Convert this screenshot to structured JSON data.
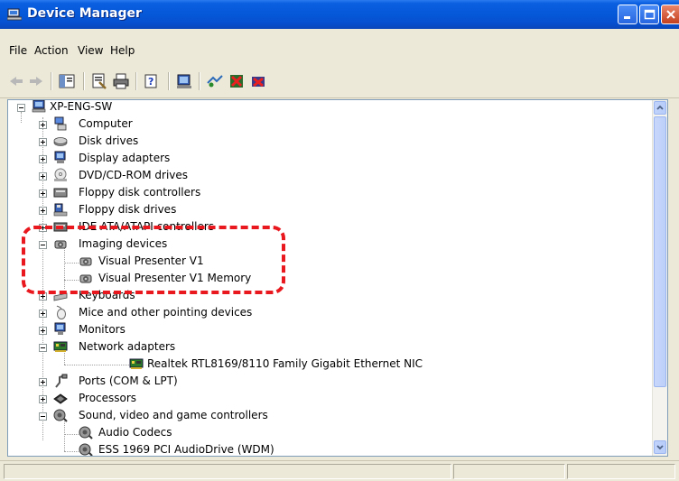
{
  "window": {
    "title": "Device Manager"
  },
  "menu": {
    "file": "File",
    "action": "Action",
    "view": "View",
    "help": "Help"
  },
  "tree": {
    "root": "XP-ENG-SW",
    "items": [
      {
        "label": "Computer",
        "icon": "computer-icon"
      },
      {
        "label": "Disk drives",
        "icon": "disk-drive-icon"
      },
      {
        "label": "Display adapters",
        "icon": "display-adapter-icon"
      },
      {
        "label": "DVD/CD-ROM drives",
        "icon": "cd-drive-icon"
      },
      {
        "label": "Floppy disk controllers",
        "icon": "floppy-controller-icon"
      },
      {
        "label": "Floppy disk drives",
        "icon": "floppy-drive-icon"
      },
      {
        "label": "IDE ATA/ATAPI controllers",
        "icon": "ide-controller-icon"
      },
      {
        "label": "Imaging devices",
        "icon": "camera-icon",
        "children": [
          "Visual Presenter V1",
          "Visual Presenter V1 Memory"
        ]
      },
      {
        "label": "Keyboards",
        "icon": "keyboard-icon"
      },
      {
        "label": "Mice and other pointing devices",
        "icon": "mouse-icon"
      },
      {
        "label": "Monitors",
        "icon": "monitor-icon"
      },
      {
        "label": "Network adapters",
        "icon": "network-card-icon",
        "children": [
          "Realtek RTL8169/8110 Family Gigabit Ethernet NIC"
        ]
      },
      {
        "label": "Ports (COM & LPT)",
        "icon": "port-icon"
      },
      {
        "label": "Processors",
        "icon": "processor-icon"
      },
      {
        "label": "Sound, video and game controllers",
        "icon": "sound-icon",
        "children": [
          "Audio Codecs",
          "ESS 1969 PCI AudioDrive (WDM)"
        ]
      }
    ]
  },
  "colors": {
    "titlebar": "#0558d8",
    "annotation": "#e8181e",
    "chrome": "#ece9d8"
  }
}
